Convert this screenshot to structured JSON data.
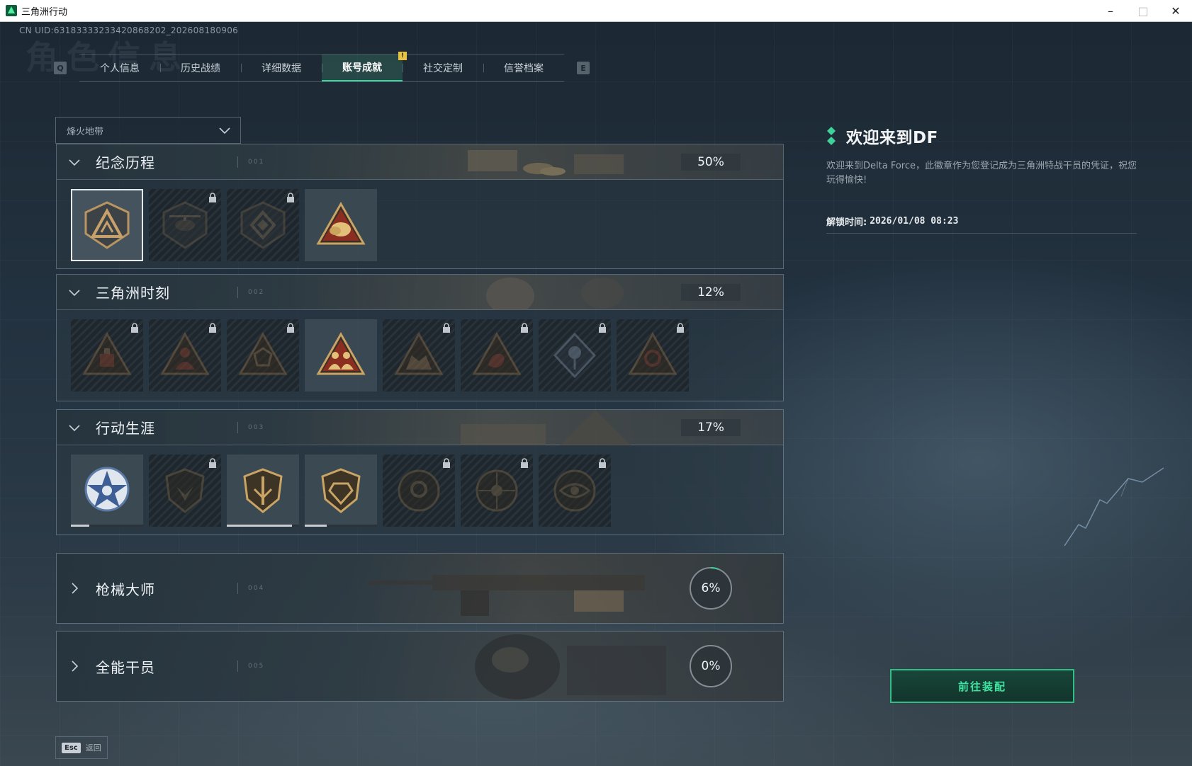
{
  "window": {
    "title": "三角洲行动"
  },
  "uid": "CN UID:6318333323342086820​2_202608180906",
  "background_title": "角色信息",
  "tabs": {
    "prev_key": "Q",
    "next_key": "E",
    "items": [
      {
        "label": "个人信息"
      },
      {
        "label": "历史战绩"
      },
      {
        "label": "详细数据"
      },
      {
        "label": "账号成就",
        "active": true
      },
      {
        "label": "社交定制",
        "notification": "!"
      },
      {
        "label": "信誉档案"
      }
    ]
  },
  "mode_select": {
    "value": "烽火地带"
  },
  "categories": [
    {
      "title": "纪念历程",
      "count": "001",
      "percent": "50%",
      "expanded": true,
      "badges": [
        {
          "name": "welcome-df",
          "locked": false,
          "selected": true
        },
        {
          "name": "helicopter",
          "locked": true
        },
        {
          "name": "drone-core",
          "locked": true
        },
        {
          "name": "golden-egg",
          "locked": false
        }
      ]
    },
    {
      "title": "三角洲时刻",
      "count": "002",
      "percent": "12%",
      "expanded": true,
      "badges": [
        {
          "name": "supply-crate",
          "locked": true
        },
        {
          "name": "operator",
          "locked": true
        },
        {
          "name": "shield-core",
          "locked": true
        },
        {
          "name": "team-squad",
          "locked": false
        },
        {
          "name": "beast-squad",
          "locked": true
        },
        {
          "name": "dragon",
          "locked": true
        },
        {
          "name": "rose",
          "locked": true
        },
        {
          "name": "skull-rune",
          "locked": true
        }
      ]
    },
    {
      "title": "行动生涯",
      "count": "003",
      "percent": "17%",
      "expanded": true,
      "badges": [
        {
          "name": "star-elite",
          "locked": false,
          "progress": 0.25
        },
        {
          "name": "eagle-shield",
          "locked": true
        },
        {
          "name": "blade-shield",
          "locked": false,
          "progress": 0.9
        },
        {
          "name": "gem-shield",
          "locked": false,
          "progress": 0.3
        },
        {
          "name": "target-ring",
          "locked": true
        },
        {
          "name": "skull-scope",
          "locked": true
        },
        {
          "name": "eye-ring",
          "locked": true
        }
      ]
    },
    {
      "title": "枪械大师",
      "count": "004",
      "percent": "6%",
      "progress": 0.06,
      "expanded": false
    },
    {
      "title": "全能干员",
      "count": "005",
      "percent": "0%",
      "progress": 0,
      "expanded": false
    }
  ],
  "detail": {
    "title": "欢迎来到DF",
    "description": "欢迎来到Delta Force，此徽章作为您登记成为三角洲特战干员的凭证，祝您玩得愉快!",
    "unlock_label": "解锁时间:",
    "unlock_time": "2026/01/08 08:23"
  },
  "equip_button": "前往装配",
  "footer": {
    "key": "Esc",
    "label": "返回"
  },
  "colors": {
    "accent": "#3ed19a",
    "notification": "#e7c341"
  }
}
